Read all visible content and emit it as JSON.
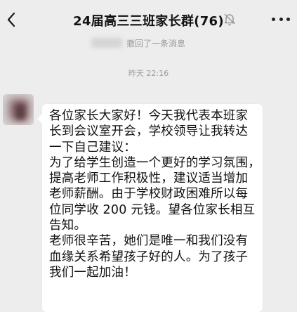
{
  "header": {
    "title": "24届高三三班家长群(76)",
    "back_icon": "chevron-left-icon",
    "mute_icon": "bell-muted-icon",
    "more_icon": "more-dots-icon"
  },
  "chat": {
    "recall_notice": "撤回了一条消息",
    "timestamp": "昨天 22:16",
    "message_text": "各位家长大家好！今天我代表本班家\n长到会议室开会，学校领导让我转达\n一下自己建议：\n为了给学生创造一个更好的学习氛围，\n提高老师工作积极性，建议适当增加\n老师薪酬。由于学校财政困难所以每\n位同学收 200 元钱。望各位家长相互\n告知。\n老师很辛苦，她们是唯一和我们没有\n血缘关系希望孩子好的人。为了孩子\n我们一起加油！"
  }
}
